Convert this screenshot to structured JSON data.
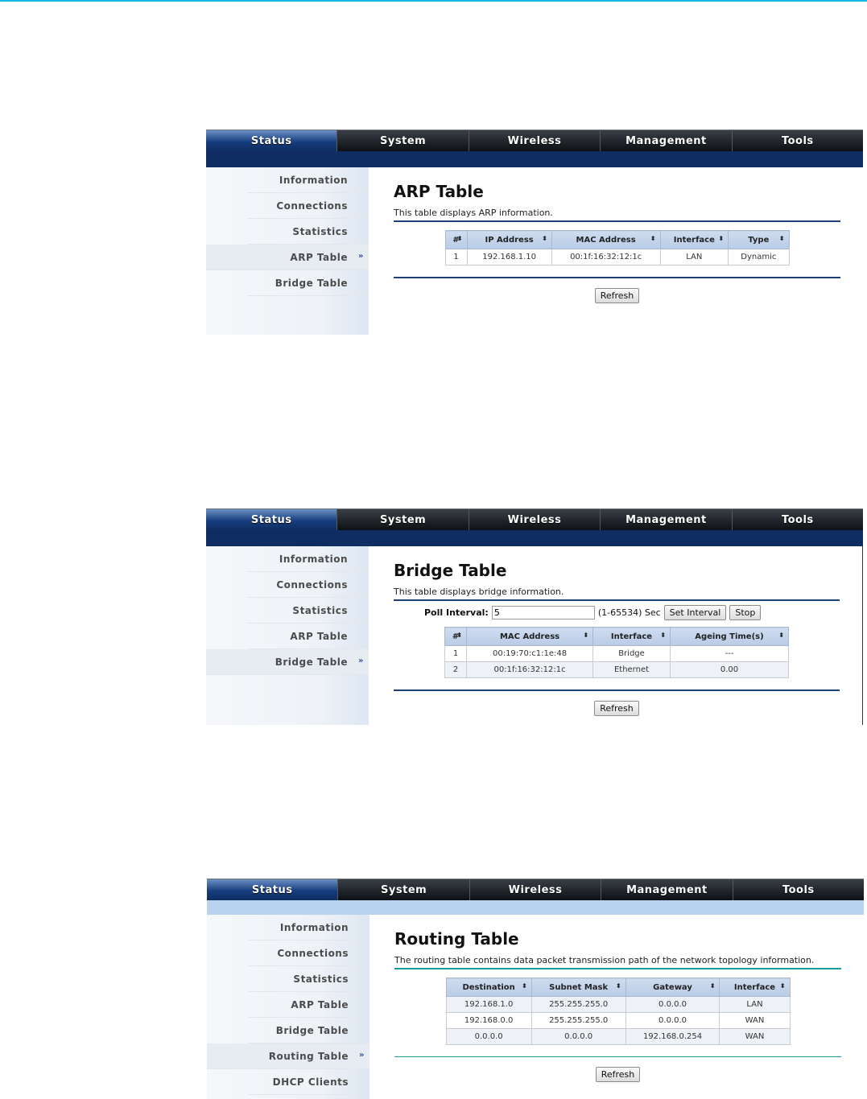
{
  "nav_tabs": [
    "Status",
    "System",
    "Wireless",
    "Management",
    "Tools"
  ],
  "arp_panel": {
    "sidebar": [
      "Information",
      "Connections",
      "Statistics",
      "ARP Table",
      "Bridge Table"
    ],
    "active_item": "ARP Table",
    "title": "ARP Table",
    "description": "This table displays ARP information.",
    "columns": [
      "#",
      "IP Address",
      "MAC Address",
      "Interface",
      "Type"
    ],
    "rows": [
      [
        "1",
        "192.168.1.10",
        "00:1f:16:32:12:1c",
        "LAN",
        "Dynamic"
      ]
    ],
    "refresh_label": "Refresh"
  },
  "bridge_panel": {
    "sidebar": [
      "Information",
      "Connections",
      "Statistics",
      "ARP Table",
      "Bridge Table"
    ],
    "active_item": "Bridge Table",
    "title": "Bridge Table",
    "description": "This table displays bridge information.",
    "poll_label": "Poll Interval:",
    "poll_value": "5",
    "poll_range": "(1-65534) Sec",
    "set_interval_label": "Set Interval",
    "stop_label": "Stop",
    "columns": [
      "#",
      "MAC Address",
      "Interface",
      "Ageing Time(s)"
    ],
    "rows": [
      [
        "1",
        "00:19:70:c1:1e:48",
        "Bridge",
        "---"
      ],
      [
        "2",
        "00:1f:16:32:12:1c",
        "Ethernet",
        "0.00"
      ]
    ],
    "refresh_label": "Refresh"
  },
  "routing_panel": {
    "sidebar": [
      "Information",
      "Connections",
      "Statistics",
      "ARP Table",
      "Bridge Table",
      "Routing Table",
      "DHCP Clients"
    ],
    "active_item": "Routing Table",
    "title": "Routing Table",
    "description": "The routing table contains data packet transmission path of the network topology information.",
    "columns": [
      "Destination",
      "Subnet Mask",
      "Gateway",
      "Interface"
    ],
    "rows": [
      [
        "192.168.1.0",
        "255.255.255.0",
        "0.0.0.0",
        "LAN"
      ],
      [
        "192.168.0.0",
        "255.255.255.0",
        "0.0.0.0",
        "WAN"
      ],
      [
        "0.0.0.0",
        "0.0.0.0",
        "192.168.0.254",
        "WAN"
      ]
    ],
    "refresh_label": "Refresh"
  },
  "colors": {
    "nav_active": "#163e7e",
    "sub_bar_dark": "#0f2d62",
    "sub_bar_light": "#b9d2ef",
    "rule_blue": "#1f3f7a",
    "rule_teal": "#1a9a9a"
  }
}
